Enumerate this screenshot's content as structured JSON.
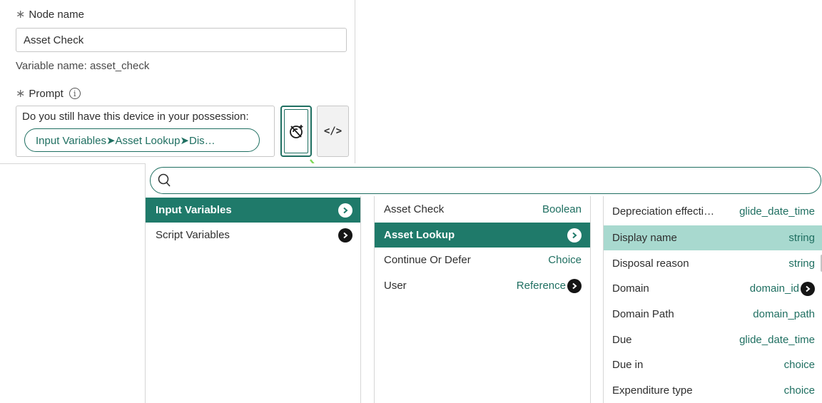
{
  "form": {
    "node_name_label": "Node name",
    "node_name_value": "Asset Check",
    "variable_name": "Variable name: asset_check",
    "prompt_label": "Prompt",
    "prompt_text": "Do you still have this device in your possession:",
    "pill_text": "Input Variables➤Asset Lookup➤Dis…",
    "code_button_label": "</>",
    "required_mark": "∗",
    "info_glyph": "i"
  },
  "picker": {
    "search_placeholder": "",
    "col1": [
      {
        "label": "Input Variables",
        "selected": true
      },
      {
        "label": "Script Variables",
        "selected": false
      }
    ],
    "col2": [
      {
        "label": "Asset Check",
        "type": "Boolean"
      },
      {
        "label": "Asset Lookup",
        "type": ""
      },
      {
        "label": "Continue Or Defer",
        "type": "Choice"
      },
      {
        "label": "User",
        "type": "Reference"
      }
    ],
    "col3": [
      {
        "label": "Depreciation effecti…",
        "type": "glide_date_time"
      },
      {
        "label": "Display name",
        "type": "string"
      },
      {
        "label": "Disposal reason",
        "type": "string"
      },
      {
        "label": "Domain",
        "type": "domain_id"
      },
      {
        "label": "Domain Path",
        "type": "domain_path"
      },
      {
        "label": "Due",
        "type": "glide_date_time"
      },
      {
        "label": "Due in",
        "type": "choice"
      },
      {
        "label": "Expenditure type",
        "type": "choice"
      }
    ]
  },
  "colors": {
    "accent": "#1f7a6a",
    "hover": "#a8d9cf",
    "arrow": "#7ed957"
  }
}
